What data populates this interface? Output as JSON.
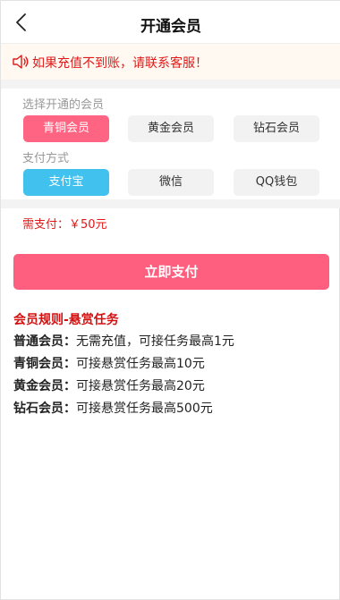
{
  "header": {
    "title": "开通会员",
    "back_icon": "chevron-left-icon"
  },
  "notice": {
    "icon": "speaker-icon",
    "text": "如果充值不到账，请联系客服！",
    "color": "#e21818"
  },
  "membership": {
    "label": "选择开通的会员",
    "options": [
      {
        "label": "青铜会员",
        "selected": true
      },
      {
        "label": "黄金会员",
        "selected": false
      },
      {
        "label": "钻石会员",
        "selected": false
      }
    ]
  },
  "payment": {
    "label": "支付方式",
    "options": [
      {
        "label": "支付宝",
        "selected": true
      },
      {
        "label": "微信",
        "selected": false
      },
      {
        "label": "QQ钱包",
        "selected": false
      }
    ]
  },
  "amount": {
    "text": "需支付：￥50元"
  },
  "pay_button": {
    "label": "立即支付",
    "color": "#fe5f7f"
  },
  "rules": {
    "title": "会员规则-悬赏任务",
    "rows": [
      {
        "key": "普通会员：",
        "value": "无需充值，可接任务最高1元"
      },
      {
        "key": "青铜会员：",
        "value": "可接悬赏任务最高10元"
      },
      {
        "key": "黄金会员：",
        "value": "可接悬赏任务最高20元"
      },
      {
        "key": "钻石会员：",
        "value": "可接悬赏任务最高500元"
      }
    ]
  },
  "colors": {
    "accent_pink": "#ff6482",
    "accent_blue": "#41c1ed",
    "warning_red": "#e21818"
  }
}
